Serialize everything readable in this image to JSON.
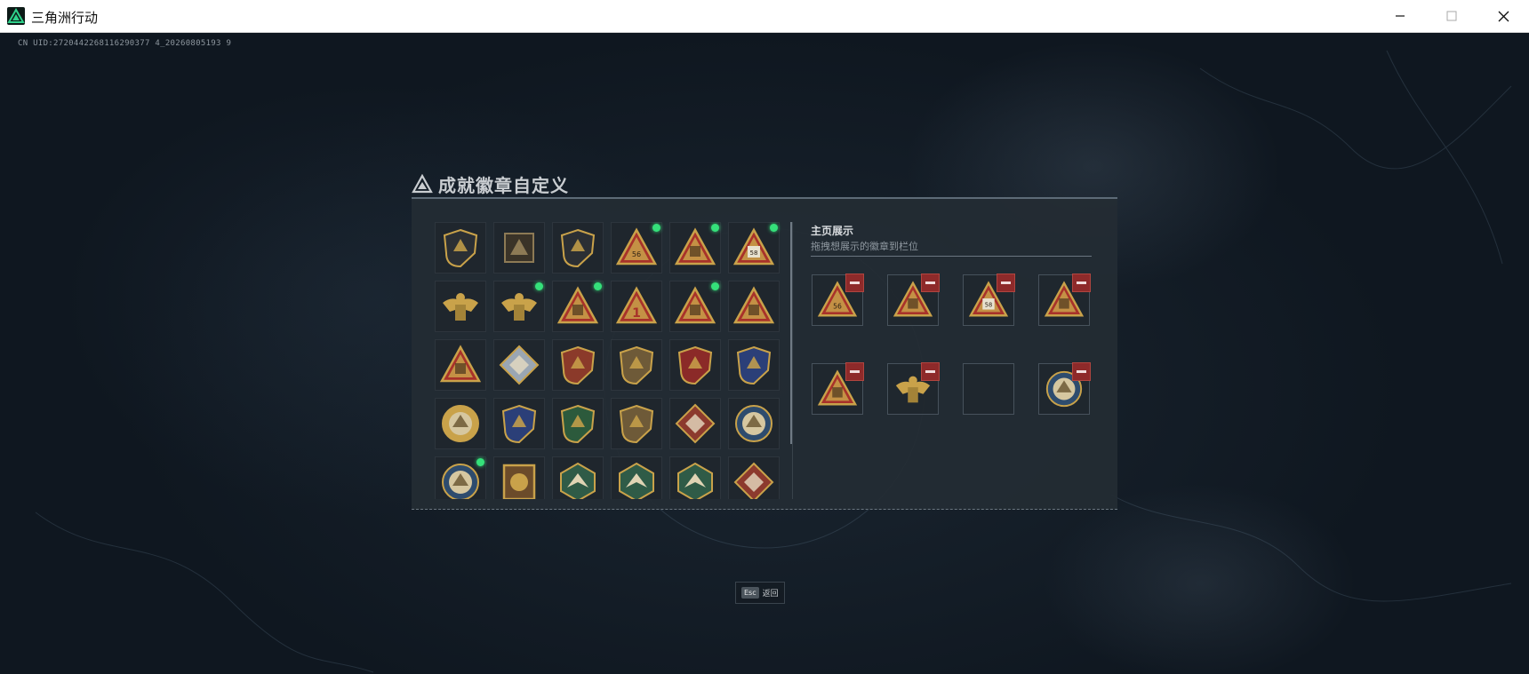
{
  "window": {
    "title": "三角洲行动",
    "controls": [
      "minimize-icon",
      "maximize-icon",
      "close-icon"
    ]
  },
  "uid_text": "CN UID:2720442268116290377 4_20260805193 9",
  "panel": {
    "title": "成就徽章自定义",
    "showcase_title": "主页展示",
    "showcase_subtitle": "拖拽想展示的徽章到栏位"
  },
  "badges": [
    {
      "icon": "shield-delta-badge-icon",
      "new": false
    },
    {
      "icon": "helicopter-badge-icon",
      "new": false
    },
    {
      "icon": "shield-arrow-badge-icon",
      "new": false
    },
    {
      "icon": "helmet-56-triangle-badge-icon",
      "new": true
    },
    {
      "icon": "armor-triangle-badge-icon",
      "new": true
    },
    {
      "icon": "canister-58-triangle-badge-icon",
      "new": true
    },
    {
      "icon": "tower-badge-icon",
      "new": false
    },
    {
      "icon": "eagle-crest-badge-icon",
      "new": true
    },
    {
      "icon": "helmet-triangle-badge-icon",
      "new": true
    },
    {
      "icon": "number-one-triangle-badge-icon",
      "new": false
    },
    {
      "icon": "vest-triangle-badge-icon",
      "new": true
    },
    {
      "icon": "ruins-triangle-badge-icon",
      "new": false
    },
    {
      "icon": "rocket-triangle-badge-icon",
      "new": false
    },
    {
      "icon": "silver-diamond-badge-icon",
      "new": false
    },
    {
      "icon": "star-shield-badge-icon",
      "new": false
    },
    {
      "icon": "gold-chevron-shield-badge-icon",
      "new": false
    },
    {
      "icon": "red-star-shield-badge-icon",
      "new": false
    },
    {
      "icon": "blue-wolf-shield-badge-icon",
      "new": false
    },
    {
      "icon": "gold-lion-round-badge-icon",
      "new": false
    },
    {
      "icon": "blue-compass-shield-badge-icon",
      "new": false
    },
    {
      "icon": "green-falcon-shield-badge-icon",
      "new": false
    },
    {
      "icon": "gold-stars-shield-badge-icon",
      "new": false
    },
    {
      "icon": "red-wolf-diamond-badge-icon",
      "new": false
    },
    {
      "icon": "wolf-round-badge-icon",
      "new": false
    },
    {
      "icon": "wolf-round-badge-2-icon",
      "new": true
    },
    {
      "icon": "lion-square-badge-icon",
      "new": false
    },
    {
      "icon": "green-hex-eagle-badge-icon",
      "new": false
    },
    {
      "icon": "green-hex-eagle-badge-2-icon",
      "new": false
    },
    {
      "icon": "green-hex-medic-badge-icon",
      "new": false
    },
    {
      "icon": "red-wolf-diamond-badge-2-icon",
      "new": false
    }
  ],
  "showcase_slots": [
    {
      "icon": "helmet-56-triangle-badge-icon",
      "filled": true
    },
    {
      "icon": "armor-triangle-badge-icon",
      "filled": true
    },
    {
      "icon": "canister-58-triangle-badge-icon",
      "filled": true
    },
    {
      "icon": "vest-triangle-badge-icon",
      "filled": true
    },
    {
      "icon": "helmet-triangle-badge-icon",
      "filled": true
    },
    {
      "icon": "eagle-crest-badge-icon",
      "filled": true
    },
    {
      "icon": "",
      "filled": false
    },
    {
      "icon": "wolf-round-badge-icon",
      "filled": true
    }
  ],
  "esc": {
    "key": "Esc",
    "label": "返回"
  },
  "colors": {
    "accent_green": "#35e07a",
    "remove_red": "#8e2a2a",
    "gold": "#c9a24a"
  }
}
